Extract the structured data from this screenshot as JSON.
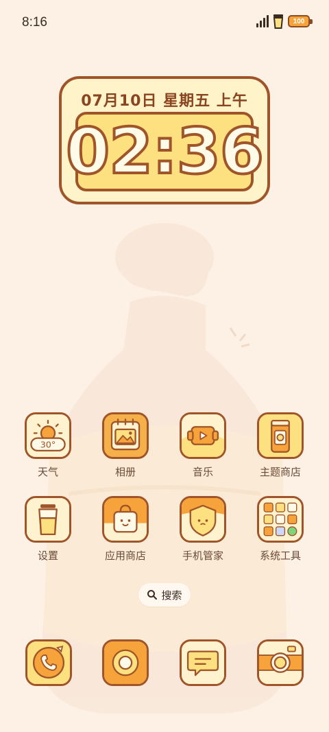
{
  "status_bar": {
    "time": "8:16",
    "battery": "100"
  },
  "clock_widget": {
    "date": "07月10日  星期五  上午",
    "time": "02:36"
  },
  "apps": [
    {
      "id": "weather",
      "label": "天气",
      "temp": "30°",
      "icon": "weather-icon"
    },
    {
      "id": "gallery",
      "label": "相册",
      "icon": "gallery-icon"
    },
    {
      "id": "music",
      "label": "音乐",
      "icon": "music-icon"
    },
    {
      "id": "themes",
      "label": "主题商店",
      "icon": "themes-icon"
    },
    {
      "id": "settings",
      "label": "设置",
      "icon": "settings-icon"
    },
    {
      "id": "app-store",
      "label": "应用商店",
      "icon": "app-store-icon"
    },
    {
      "id": "security",
      "label": "手机管家",
      "icon": "security-icon"
    },
    {
      "id": "tools",
      "label": "系统工具",
      "icon": "tools-folder-icon"
    }
  ],
  "search": {
    "label": "搜索"
  },
  "dock": [
    {
      "id": "phone",
      "icon": "phone-icon"
    },
    {
      "id": "browser",
      "icon": "browser-icon"
    },
    {
      "id": "messages",
      "icon": "messages-icon"
    },
    {
      "id": "camera",
      "icon": "camera-icon"
    }
  ],
  "colors": {
    "background": "#fdf1e6",
    "outline": "#a0542a",
    "accent_yellow": "#fde080",
    "accent_orange": "#f6a33b",
    "cream": "#fff3c9"
  }
}
